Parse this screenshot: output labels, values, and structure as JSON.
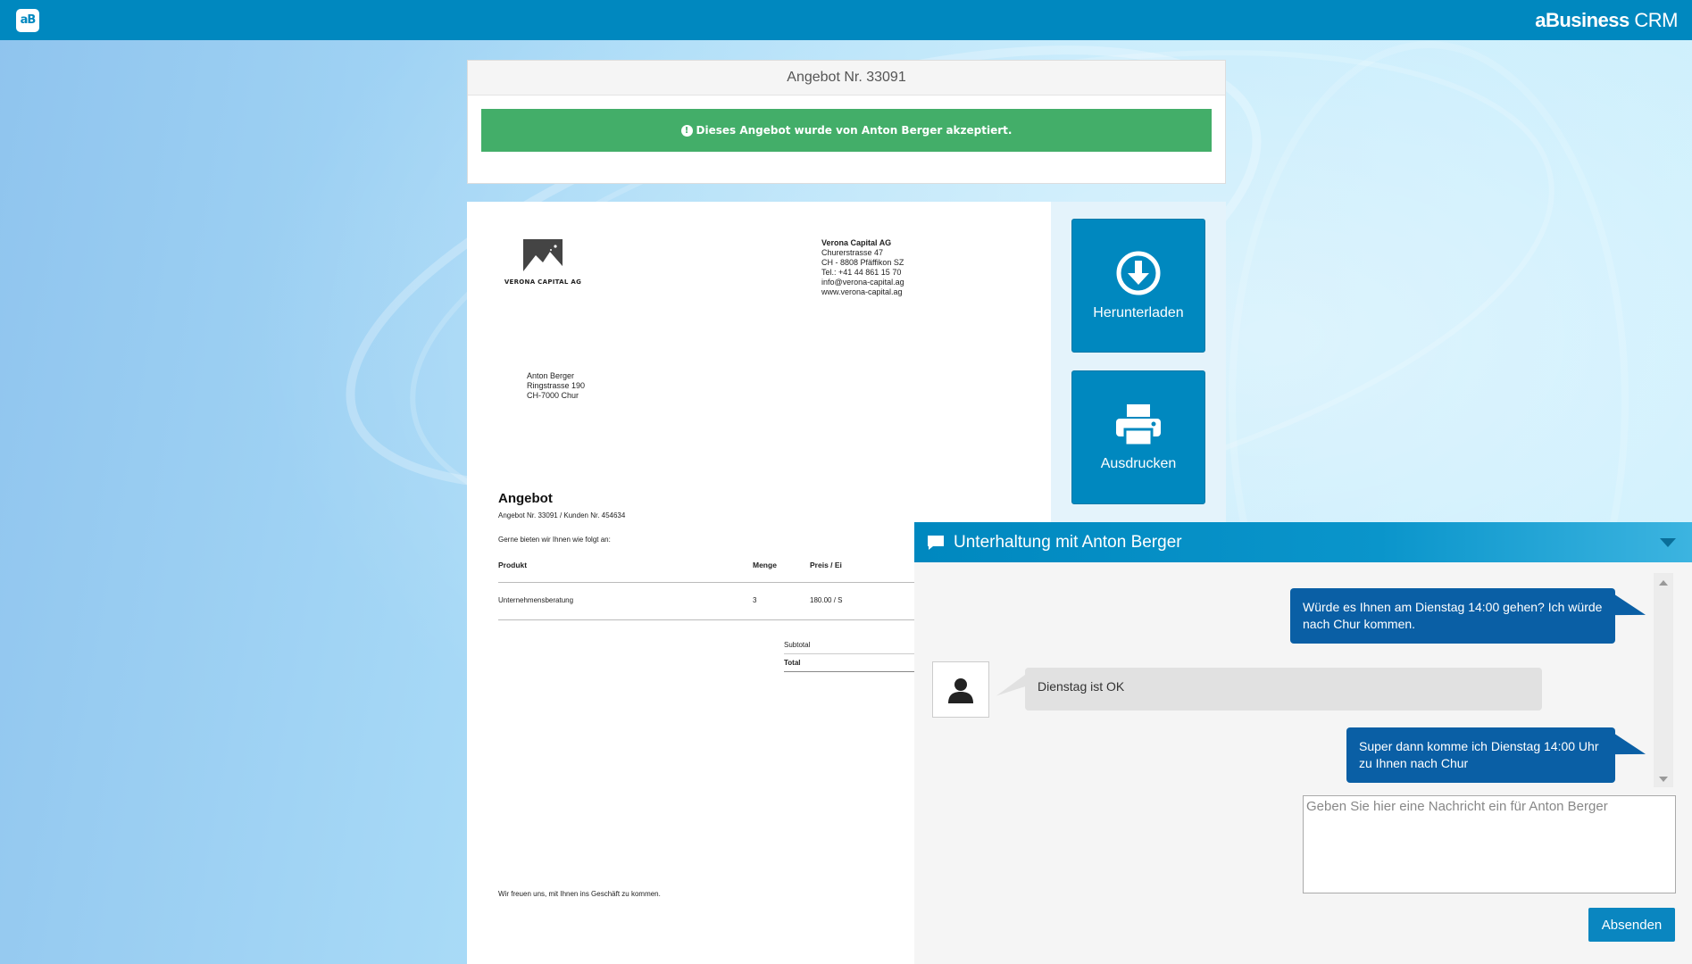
{
  "app": {
    "logo_text": "aB",
    "brand_bold": "aBusiness",
    "brand_light": "CRM"
  },
  "offer": {
    "title": "Angebot Nr. 33091",
    "accepted_message": "Dieses Angebot wurde von Anton Berger akzeptiert.",
    "accepted_color": "#43ae69"
  },
  "actions": {
    "download_label": "Herunterladen",
    "print_label": "Ausdrucken"
  },
  "document": {
    "company_logo_name": "VERONA CAPITAL AG",
    "sender": {
      "company": "Verona Capital AG",
      "street": "Churerstrasse 47",
      "city": "CH - 8808 Pfäffikon SZ",
      "phone": "Tel.: +41 44 861 15 70",
      "email": "info@verona-capital.ag",
      "web": "www.verona-capital.ag"
    },
    "recipient": {
      "name": "Anton Berger",
      "street": "Ringstrasse 190",
      "city": "CH-7000 Chur"
    },
    "heading": "Angebot",
    "reference": "Angebot Nr. 33091 / Kunden Nr. 454634",
    "intro": "Gerne bieten wir Ihnen wie folgt an:",
    "table": {
      "headers": [
        "Produkt",
        "Menge",
        "Preis / Ei"
      ],
      "rows": [
        {
          "product": "Unternehmensberatung",
          "qty": "3",
          "price": "180.00 / S"
        }
      ],
      "subtotal_label": "Subtotal",
      "total_label": "Total"
    },
    "closing": "Wir freuen uns, mit Ihnen ins Geschäft zu kommen."
  },
  "chat": {
    "title": "Unterhaltung mit Anton Berger",
    "messages": [
      {
        "direction": "out",
        "text": "Würde es Ihnen am Dienstag 14:00 gehen? Ich würde nach Chur kommen."
      },
      {
        "direction": "in",
        "text": "Dienstag ist OK"
      },
      {
        "direction": "out",
        "text": "Super dann komme ich Dienstag 14:00 Uhr zu Ihnen nach Chur"
      }
    ],
    "input_placeholder": "Geben Sie hier eine Nachricht ein für Anton Berger",
    "send_label": "Absenden"
  }
}
